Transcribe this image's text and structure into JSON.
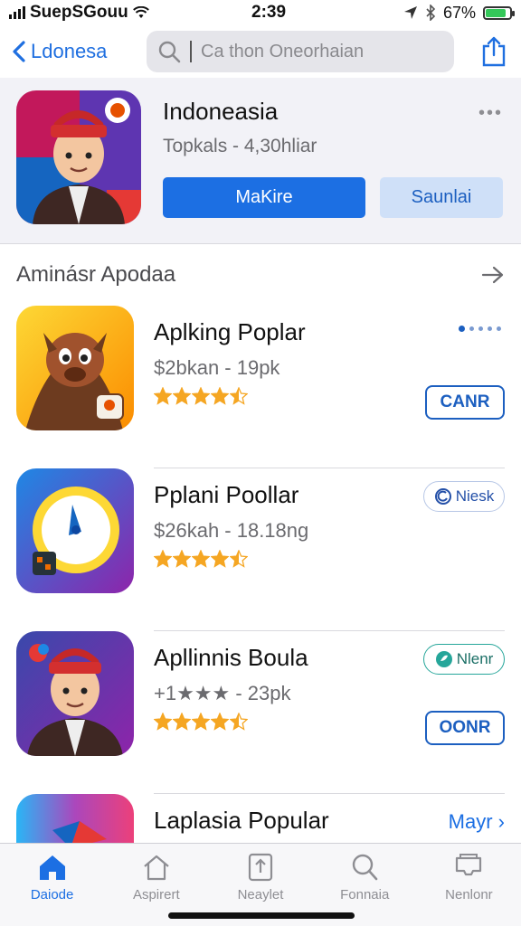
{
  "status_bar": {
    "carrier": "SuepSGouu",
    "time": "2:39",
    "battery": "67%",
    "battery_level": 0.85
  },
  "nav": {
    "back_label": "Ldonesa",
    "search_placeholder": "Ca thon Oneorhaian"
  },
  "featured": {
    "title": "Indoneasia",
    "subtitle": "Topkals - 4,30hliar",
    "more": "•••",
    "primary_button": "MaKire",
    "secondary_button": "Saunlai"
  },
  "section": {
    "title": "Aminásr Apodaa"
  },
  "apps": [
    {
      "name": "Aplking Poplar",
      "subtitle": "$2bkan - 19pk",
      "rating": 4.5,
      "action": "CANR"
    },
    {
      "name": "Pplani  Poollar",
      "subtitle": "$26kah - 18.18ng",
      "rating": 4.5,
      "badge": "Niesk"
    },
    {
      "name": "Apllinnis Boula",
      "subtitle": "+1★★★ - 23pk",
      "rating": 4.5,
      "badge": "Nlenr",
      "action": "OONR"
    },
    {
      "name": "Laplasia Popular",
      "more_link": "Mayr ›"
    }
  ],
  "tabs": [
    {
      "label": "Daiode",
      "icon": "home-icon",
      "active": true
    },
    {
      "label": "Aspirert",
      "icon": "house-outline-icon",
      "active": false
    },
    {
      "label": "Neaylet",
      "icon": "upload-icon",
      "active": false
    },
    {
      "label": "Fonnaia",
      "icon": "search-icon",
      "active": false
    },
    {
      "label": "Nenlonr",
      "icon": "tray-icon",
      "active": false
    }
  ],
  "colors": {
    "accent": "#1c6fe3",
    "star": "#f5a623",
    "battery": "#34c759"
  }
}
